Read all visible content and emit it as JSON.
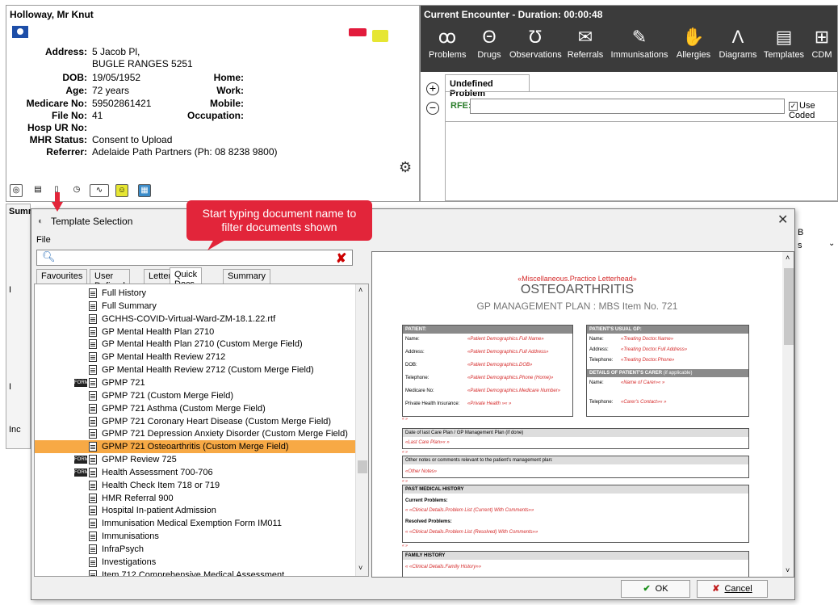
{
  "patient": {
    "name": "Holloway, Mr Knut",
    "address_label": "Address:",
    "address_line1": "5 Jacob Pl,",
    "address_line2": "BUGLE RANGES  5251",
    "dob_label": "DOB:",
    "dob": "19/05/1952",
    "age_label": "Age:",
    "age": "72 years",
    "medicare_label": "Medicare No:",
    "medicare": "59502861421",
    "file_label": "File No:",
    "file": "41",
    "hosp_label": "Hosp UR No:",
    "mhr_label": "MHR Status:",
    "mhr": "Consent to Upload",
    "referrer_label": "Referrer:",
    "referrer": "Adelaide Path Partners (Ph: 08 8238 9800)",
    "home_label": "Home:",
    "work_label": "Work:",
    "mobile_label": "Mobile:",
    "occupation_label": "Occupation:"
  },
  "encounter": {
    "title": "Current Encounter - Duration: 00:00:48",
    "tools": [
      {
        "label": "Problems",
        "icon": "people-icon"
      },
      {
        "label": "Drugs",
        "icon": "pills-icon"
      },
      {
        "label": "Observations",
        "icon": "stethoscope-icon"
      },
      {
        "label": "Referrals",
        "icon": "envelope-icon"
      },
      {
        "label": "Immunisations",
        "icon": "syringe-icon"
      },
      {
        "label": "Allergies",
        "icon": "hand-icon"
      },
      {
        "label": "Diagrams",
        "icon": "compass-icon"
      },
      {
        "label": "Templates",
        "icon": "document-icon"
      },
      {
        "label": "CDM",
        "icon": "first-aid-icon"
      }
    ],
    "problem_tab": "Undefined Problem",
    "rfe_label": "RFE:",
    "use_coded": "Use Coded"
  },
  "background": {
    "summary_label": "Summ",
    "side_letters": [
      "I",
      "I",
      "Inc"
    ],
    "right_b": "B",
    "right_s": "s"
  },
  "tooltip": {
    "line1": "Start typing document name to",
    "line2": "filter documents shown"
  },
  "dialog": {
    "title": "Template Selection",
    "menu_file": "File",
    "search_value": "",
    "tabs": [
      "Favourites",
      "User Defined",
      "Letter",
      "Quick Docs",
      "Summary"
    ],
    "active_tab": "Quick Docs",
    "items": [
      {
        "label": "Full History",
        "form": false
      },
      {
        "label": "Full Summary",
        "form": false
      },
      {
        "label": "GCHHS-COVID-Virtual-Ward-ZM-18.1.22.rtf",
        "form": false
      },
      {
        "label": "GP Mental Health Plan 2710",
        "form": false
      },
      {
        "label": "GP Mental Health Plan 2710 (Custom Merge Field)",
        "form": false
      },
      {
        "label": "GP Mental Health Review 2712",
        "form": false
      },
      {
        "label": "GP Mental Health Review 2712 (Custom Merge Field)",
        "form": false
      },
      {
        "label": "GPMP 721",
        "form": true
      },
      {
        "label": "GPMP 721 (Custom Merge Field)",
        "form": false
      },
      {
        "label": "GPMP 721 Asthma (Custom Merge Field)",
        "form": false
      },
      {
        "label": "GPMP 721 Coronary Heart Disease (Custom Merge Field)",
        "form": false
      },
      {
        "label": "GPMP 721 Depression Anxiety Disorder (Custom Merge Field)",
        "form": false
      },
      {
        "label": "GPMP 721 Osteoarthritis (Custom Merge Field)",
        "form": false,
        "selected": true
      },
      {
        "label": "GPMP Review 725",
        "form": true
      },
      {
        "label": "Health Assessment 700-706",
        "form": true
      },
      {
        "label": "Health Check Item 718 or 719",
        "form": false
      },
      {
        "label": "HMR Referral 900",
        "form": false
      },
      {
        "label": "Hospital In-patient Admission",
        "form": false
      },
      {
        "label": "Immunisation Medical Exemption Form IM011",
        "form": false
      },
      {
        "label": "Immunisations",
        "form": false
      },
      {
        "label": "InfraPsych",
        "form": false
      },
      {
        "label": "Investigations",
        "form": false
      },
      {
        "label": "Item 712 Comprehensive Medical Assessment",
        "form": false
      }
    ],
    "form_badge": "FORM",
    "ok_label": "OK",
    "cancel_label": "Cancel"
  },
  "preview": {
    "letterhead": "«Miscellaneous.Practice Letterhead»",
    "title": "OSTEOARTHRITIS",
    "subtitle": "GP MANAGEMENT PLAN  :  MBS Item No. 721",
    "patient_hdr": "PATIENT:",
    "gp_hdr": "PATIENT'S USUAL GP:",
    "carer_hdr": "DETAILS OF PATIENT'S CARER",
    "carer_note": "(if applicable)",
    "rows_left": [
      {
        "k": "Name:",
        "v": "«Patient Demographics.Full Name»"
      },
      {
        "k": "Address:",
        "v": "«Patient Demographics.Full Address»"
      },
      {
        "k": "DOB:",
        "v": "«Patient Demographics.DOB»"
      },
      {
        "k": "Telephone:",
        "v": "«Patient Demographics.Phone (Home)»"
      },
      {
        "k": "Medicare No:",
        "v": "«Patient Demographics.Medicare Number»"
      },
      {
        "k": "Private Health Insurance:",
        "v": "«Private Health »« »"
      }
    ],
    "rows_gp": [
      {
        "k": "Name:",
        "v": "«Treating Doctor.Name»"
      },
      {
        "k": "Address:",
        "v": "«Treating Doctor.Full Address»"
      },
      {
        "k": "Telephone:",
        "v": "«Treating Doctor.Phone»"
      }
    ],
    "rows_carer": [
      {
        "k": "Name:",
        "v": "«Name of Carer»« »"
      },
      {
        "k": "Telephone:",
        "v": "«Carer's Contact»« »"
      }
    ],
    "last_plan_hdr": "Date of last Care Plan / GP Management Plan  (if done)",
    "last_plan_val": "«Last Care Plan»« »",
    "other_notes_hdr": "Other notes or comments relevant to the patient's management plan:",
    "other_notes_val": "«Other Notes»",
    "pmh_hdr": "PAST MEDICAL HISTORY",
    "current_problems": "Current Problems:",
    "current_val": "« «Clinical Details.Problem List (Current) With Comments»»",
    "resolved_problems": "Resolved Problems:",
    "resolved_val": "« «Clinical Details.Problem List (Resolved) With Comments»»",
    "family_hdr": "FAMILY HISTORY",
    "family_val": "« «Clinical Details.Family History»»",
    "spacer": "« »"
  }
}
